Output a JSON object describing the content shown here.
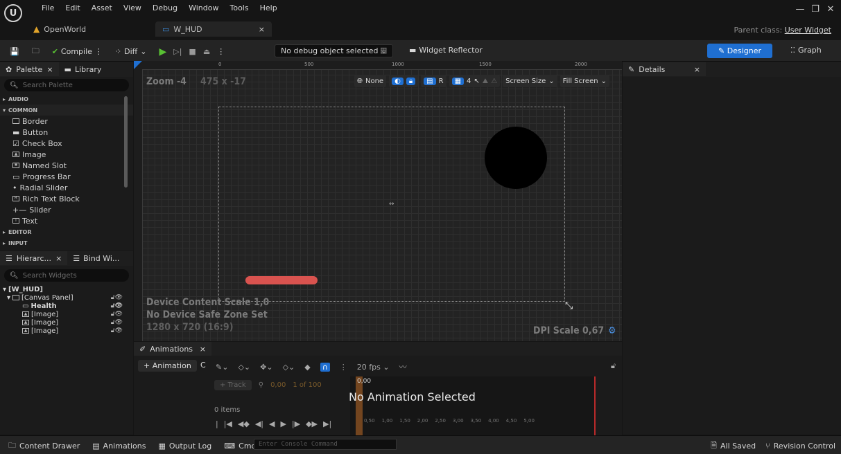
{
  "menu": [
    "File",
    "Edit",
    "Asset",
    "View",
    "Debug",
    "Window",
    "Tools",
    "Help"
  ],
  "tabs": [
    {
      "label": "OpenWorld"
    },
    {
      "label": "W_HUD"
    }
  ],
  "parent_class_prefix": "Parent class:",
  "parent_class_value": "User Widget",
  "toolbar": {
    "compile": "Compile",
    "diff": "Diff",
    "debug_object": "No debug object selected",
    "widget_reflector": "Widget Reflector",
    "designer": "Designer",
    "graph": "Graph"
  },
  "palette": {
    "tab_palette": "Palette",
    "tab_library": "Library",
    "search_placeholder": "Search Palette",
    "cat_audio": "AUDIO",
    "cat_common": "COMMON",
    "items": [
      "Border",
      "Button",
      "Check Box",
      "Image",
      "Named Slot",
      "Progress Bar",
      "Radial Slider",
      "Rich Text Block",
      "Slider",
      "Text"
    ],
    "cat_editor": "EDITOR",
    "cat_input": "INPUT"
  },
  "hierarchy": {
    "tab_hier": "Hierarc...",
    "tab_bind": "Bind Wi...",
    "search_placeholder": "Search Widgets",
    "root": "[W_HUD]",
    "canvas": "[Canvas Panel]",
    "children": [
      "Health",
      "[Image]",
      "[Image]",
      "[Image]"
    ]
  },
  "viewport": {
    "zoom": "Zoom -4",
    "size": "475 x -17",
    "ruler_h": [
      "0",
      "500",
      "1000",
      "1500",
      "2000"
    ],
    "none_label": "None",
    "r_label": "R",
    "grid_num": "4",
    "screen_size": "Screen Size",
    "fill_screen": "Fill Screen",
    "info_line1": "Device Content Scale 1,0",
    "info_line2": "No Device Safe Zone Set",
    "info_line3": "1280 x 720 (16:9)",
    "dpi_scale": "DPI Scale 0,67",
    "health_color": "#d9534f",
    "circle_color": "#000000"
  },
  "details": {
    "tab": "Details"
  },
  "animations": {
    "tab": "Animations",
    "add_animation": "+ Animation",
    "fps": "20 fps",
    "add_track": "+ Track",
    "time": "0,00",
    "frames": "1 of 100",
    "time_marker": "0,00",
    "no_animation": "No Animation Selected",
    "items": "0 items",
    "timeline_ticks": [
      "0,50",
      "1,00",
      "1,50",
      "2,00",
      "2,50",
      "3,00",
      "3,50",
      "4,00",
      "4,50",
      "5,00"
    ]
  },
  "status": {
    "content_drawer": "Content Drawer",
    "animations": "Animations",
    "output_log": "Output Log",
    "cmd": "Cmd",
    "console_placeholder": "Enter Console Command",
    "all_saved": "All Saved",
    "revision_control": "Revision Control"
  }
}
